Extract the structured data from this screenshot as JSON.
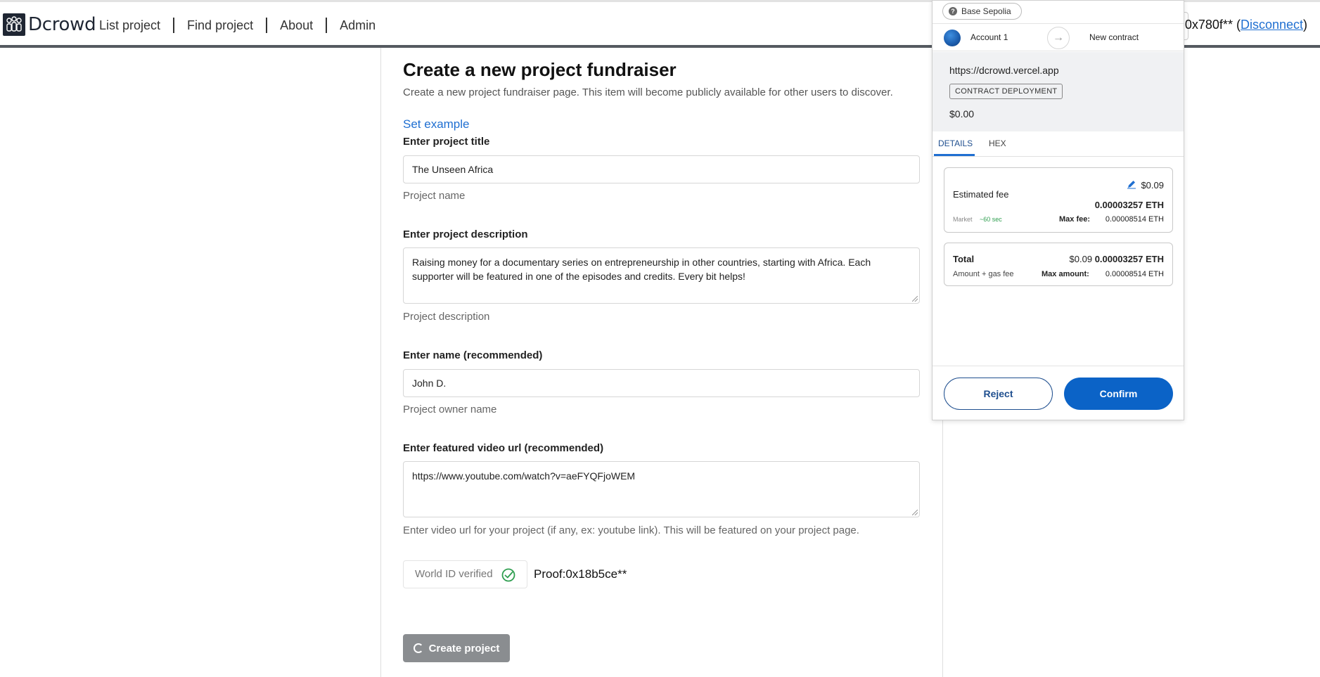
{
  "header": {
    "brand": "Dcrowd",
    "nav": [
      "List project",
      "Find project",
      "About",
      "Admin"
    ],
    "wallet_address": "0x780f**",
    "disconnect_label": "Disconnect"
  },
  "form": {
    "title": "Create a new project fundraiser",
    "subtitle": "Create a new project fundraiser page. This item will become publicly available for other users to discover.",
    "set_example": "Set example",
    "fields": {
      "title": {
        "label": "Enter project title",
        "value": "The Unseen Africa",
        "help": "Project name"
      },
      "description": {
        "label": "Enter project description",
        "value": "Raising money for a documentary series on entrepreneurship in other countries, starting with Africa. Each supporter will be featured in one of the episodes and credits. Every bit helps!",
        "help": "Project description"
      },
      "owner": {
        "label": "Enter name (recommended)",
        "value": "John D.",
        "help": "Project owner name"
      },
      "video": {
        "label": "Enter featured video url (recommended)",
        "value": "https://www.youtube.com/watch?v=aeFYQFjoWEM",
        "help": "Enter video url for your project (if any, ex: youtube link). This will be featured on your project page."
      }
    },
    "worldid_label": "World ID verified",
    "proof": "Proof:0x18b5ce**",
    "create_button": "Create project"
  },
  "wallet_popup": {
    "network": "Base Sepolia",
    "account": "Account 1",
    "target": "New contract",
    "site_url": "https://dcrowd.vercel.app",
    "tag": "CONTRACT DEPLOYMENT",
    "amount": "$0.00",
    "tabs": [
      "DETAILS",
      "HEX"
    ],
    "fee": {
      "label": "Estimated fee",
      "usd": "$0.09",
      "eth": "0.00003257 ETH",
      "speed_label": "Market",
      "speed_time": "~60 sec",
      "max_fee_label": "Max fee:",
      "max_fee_value": "0.00008514 ETH"
    },
    "total": {
      "label": "Total",
      "usd": "$0.09",
      "eth": "0.00003257 ETH",
      "sub_label": "Amount + gas fee",
      "max_amount_label": "Max amount:",
      "max_amount_value": "0.00008514 ETH"
    },
    "reject_label": "Reject",
    "confirm_label": "Confirm"
  },
  "colors": {
    "accent_blue": "#0b63c7",
    "link_blue": "#1f6fd1",
    "success_green": "#2e9e4f",
    "disabled_gray": "#8a8d90"
  }
}
